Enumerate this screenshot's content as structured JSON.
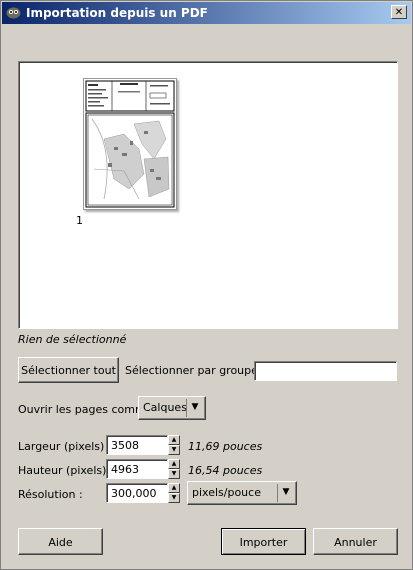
{
  "window": {
    "title": "Importation depuis un PDF",
    "close": "✕"
  },
  "preview": {
    "page_number": "1"
  },
  "status": "Rien de sélectionné",
  "select_all_button": "Sélectionner tout",
  "select_group_label": "Sélectionner par groupe :",
  "select_group_value": "",
  "open_pages_label": "Ouvrir les pages comme",
  "open_pages_value": "Calques",
  "width": {
    "label": "Largeur (pixels) :",
    "value": "3508",
    "inches": "11,69 pouces"
  },
  "height": {
    "label": "Hauteur (pixels) :",
    "value": "4963",
    "inches": "16,54 pouces"
  },
  "resolution": {
    "label": "Résolution :",
    "value": "300,000",
    "unit": "pixels/pouce"
  },
  "buttons": {
    "help": "Aide",
    "import": "Importer",
    "cancel": "Annuler"
  }
}
